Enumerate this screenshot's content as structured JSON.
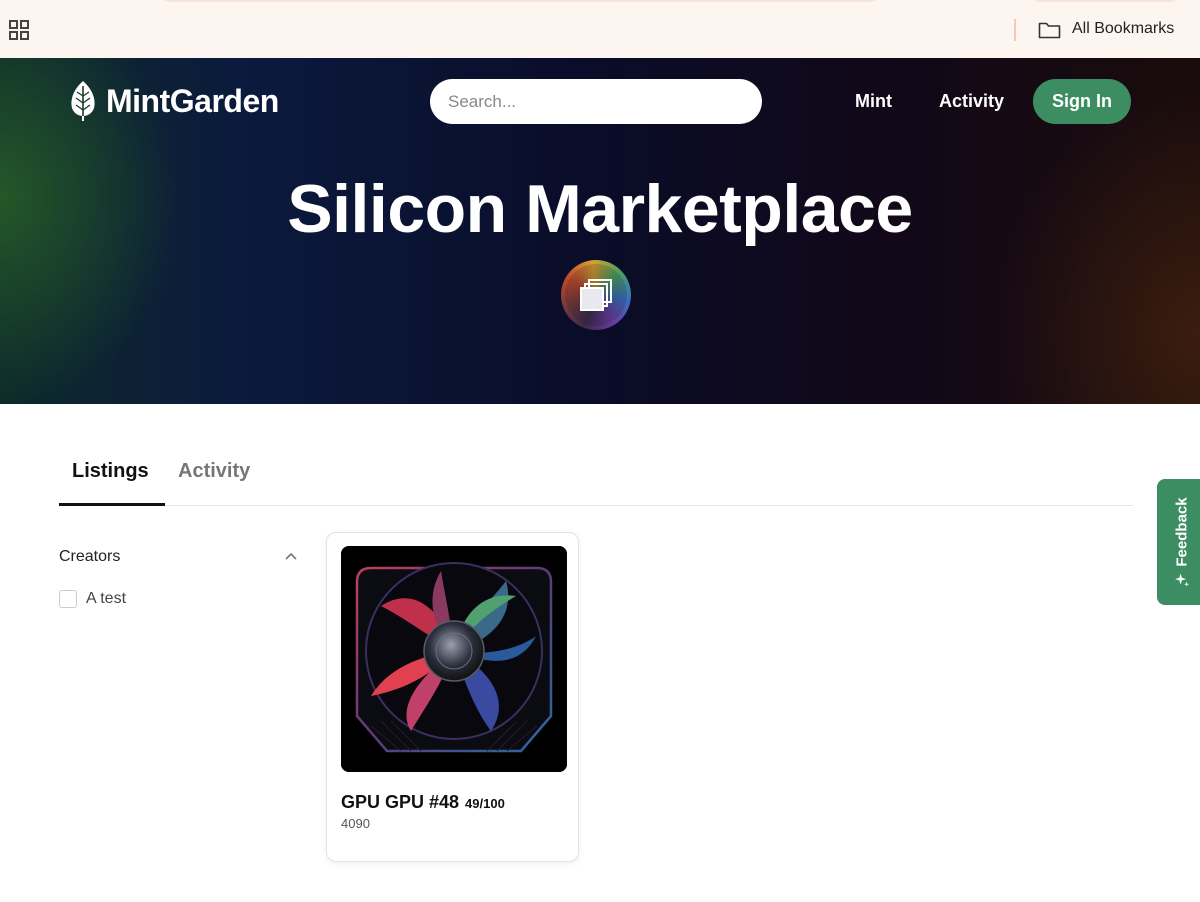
{
  "browser": {
    "apps_icon": "apps-grid-icon",
    "bookmarks_folder_icon": "folder-icon",
    "bookmarks_label": "All Bookmarks"
  },
  "header": {
    "logo_text": "MintGarden",
    "logo_icon": "leaf-icon",
    "search": {
      "placeholder": "Search..."
    },
    "nav": {
      "mint": "Mint",
      "activity": "Activity"
    },
    "sign_in": "Sign In",
    "accent_color": "#3c8e62"
  },
  "hero": {
    "title": "Silicon Marketplace",
    "avatar_icon": "collection-avatar-icon"
  },
  "tabs": [
    {
      "label": "Listings",
      "active": true
    },
    {
      "label": "Activity",
      "active": false
    }
  ],
  "filters": {
    "section_title": "Creators",
    "options": [
      {
        "label": "A test",
        "checked": false
      }
    ]
  },
  "listings": [
    {
      "name": "GPU GPU #48",
      "edition": "49/100",
      "subtitle": "4090",
      "image_icon": "gpu-fan-image"
    }
  ],
  "feedback": {
    "label": "Feedback",
    "icon": "sparkle-icon"
  }
}
